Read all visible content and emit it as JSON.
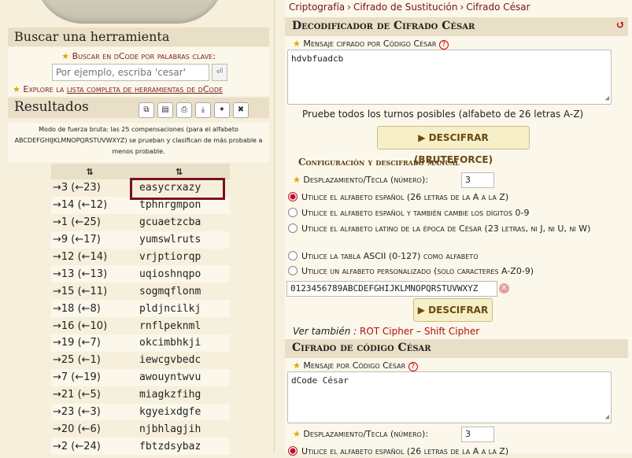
{
  "left": {
    "search_title": "Buscar una herramienta",
    "keyword_label": "Buscar en dCode por palabras clave:",
    "search_placeholder": "Por ejemplo, escriba 'cesar'",
    "explore_prefix": "Explore la ",
    "explore_link": "lista completa de herramientas de dCode",
    "results_title": "Resultados",
    "bruteforce_note": "Modo de fuerza bruta: las 25 compensaciones (para el alfabeto ABCDEFGHIJKLMNOPQRSTUVWXYZ) se prueban y clasifican de más probable a menos probable.",
    "table_headers": [
      "⇅",
      "⇅"
    ],
    "results": [
      {
        "shift": "→3 (←23)",
        "text": "easycrxazy"
      },
      {
        "shift": "→14 (←12)",
        "text": "tphnrgmpon"
      },
      {
        "shift": "→1 (←25)",
        "text": "gcuaetzcba"
      },
      {
        "shift": "→9 (←17)",
        "text": "yumswlruts"
      },
      {
        "shift": "→12 (←14)",
        "text": "vrjptiorqp"
      },
      {
        "shift": "→13 (←13)",
        "text": "uqioshnqpo"
      },
      {
        "shift": "→15 (←11)",
        "text": "sogmqflonm"
      },
      {
        "shift": "→18 (←8)",
        "text": "pldjncilkj"
      },
      {
        "shift": "→16 (←10)",
        "text": "rnflpeknml"
      },
      {
        "shift": "→19 (←7)",
        "text": "okcimbhkji"
      },
      {
        "shift": "→25 (←1)",
        "text": "iewcgvbedc"
      },
      {
        "shift": "→7 (←19)",
        "text": "awouyntwvu"
      },
      {
        "shift": "→21 (←5)",
        "text": "miagkzfihg"
      },
      {
        "shift": "→23 (←3)",
        "text": "kgyeixdgfe"
      },
      {
        "shift": "→20 (←6)",
        "text": "njbhlagjih"
      },
      {
        "shift": "→2 (←24)",
        "text": "fbtzdsybaz"
      }
    ]
  },
  "breadcrumb": [
    "Criptografía",
    "Cifrado de Sustitución",
    "Cifrado César"
  ],
  "decoder": {
    "title": "Decodificador de Cifrado César",
    "message_label": "Mensaje cifrado por Código César",
    "message_value": "hdvbfuadcb",
    "bruteforce_hint": "Pruebe todos los turnos posibles (alfabeto de 26 letras A-Z)",
    "bruteforce_button": "▶ DESCIFRAR (BRUTEFORCE)",
    "config_title": "Configuración y descifrado manual",
    "shift_label": "Desplazamiento/Tecla (número):",
    "shift_value": "3",
    "options": [
      "Utilice el alfabeto español (26 letras de la A a la Z)",
      "Utilice el alfabeto español y también cambie los dígitos 0-9",
      "Utilice el alfabeto latino de la época de César (23 letras, ni J, ni U, ni W)",
      "Utilice la tabla ASCII (0-127) como alfabeto",
      "Utilice un alfabeto personalizado (solo caracteres A-Z0-9)"
    ],
    "custom_alphabet": "0123456789ABCDEFGHIJKLMNOPQRSTUVWXYZ",
    "decrypt_button": "▶ DESCIFRAR",
    "see_also_label": "Ver también : ",
    "see_also_links": [
      "ROT Cipher",
      "Shift Cipher"
    ]
  },
  "encoder": {
    "title": "Cifrado de código César",
    "message_label": "Mensaje por Código César",
    "message_value": "dCode César",
    "shift_label": "Desplazamiento/Tecla (número):",
    "shift_value": "3",
    "option_first": "Utilice el alfabeto español (26 letras de la A a la Z)"
  }
}
